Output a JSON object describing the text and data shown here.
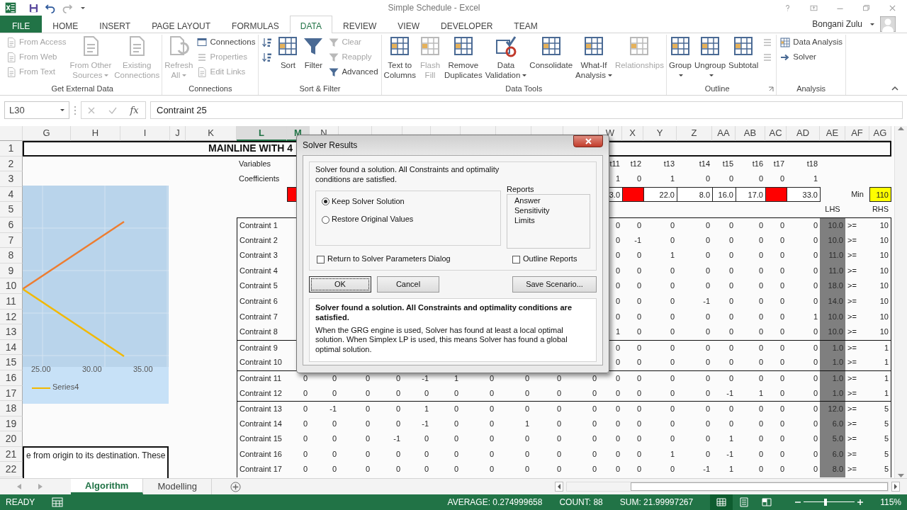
{
  "title_bar": {
    "title": "Simple Schedule - Excel"
  },
  "tabs": [
    {
      "label": "FILE",
      "kind": "file",
      "selected": false
    },
    {
      "label": "HOME",
      "kind": "tab",
      "selected": false
    },
    {
      "label": "INSERT",
      "kind": "tab",
      "selected": false
    },
    {
      "label": "PAGE LAYOUT",
      "kind": "tab",
      "selected": false
    },
    {
      "label": "FORMULAS",
      "kind": "tab",
      "selected": false
    },
    {
      "label": "DATA",
      "kind": "tab",
      "selected": true
    },
    {
      "label": "REVIEW",
      "kind": "tab",
      "selected": false
    },
    {
      "label": "VIEW",
      "kind": "tab",
      "selected": false
    },
    {
      "label": "DEVELOPER",
      "kind": "tab",
      "selected": false
    },
    {
      "label": "TEAM",
      "kind": "tab",
      "selected": false
    }
  ],
  "user": {
    "name": "Bongani Zulu"
  },
  "ribbon": [
    {
      "label": "Get External Data",
      "launcher": false,
      "columns": [
        {
          "kind": "stack",
          "items": [
            {
              "label": "From Access",
              "disabled": true
            },
            {
              "label": "From Web",
              "disabled": true
            },
            {
              "label": "From Text",
              "disabled": true
            }
          ]
        },
        {
          "kind": "large",
          "lines": [
            "From Other",
            "Sources"
          ],
          "dropdown": true,
          "disabled": true
        },
        {
          "kind": "large",
          "lines": [
            "Existing",
            "Connections"
          ],
          "dropdown": false,
          "disabled": true
        }
      ]
    },
    {
      "label": "Connections",
      "launcher": false,
      "columns": [
        {
          "kind": "large",
          "lines": [
            "Refresh",
            "All"
          ],
          "dropdown": true,
          "disabled": true
        },
        {
          "kind": "stack",
          "items": [
            {
              "label": "Connections",
              "disabled": false
            },
            {
              "label": "Properties",
              "disabled": true
            },
            {
              "label": "Edit Links",
              "disabled": true
            }
          ]
        }
      ]
    },
    {
      "label": "Sort & Filter",
      "launcher": false,
      "columns": [
        {
          "kind": "stack",
          "items": [
            {
              "disabled": false
            },
            {
              "disabled": false
            }
          ]
        },
        {
          "kind": "large",
          "lines": [
            "Sort"
          ],
          "dropdown": false,
          "disabled": false
        },
        {
          "kind": "large",
          "lines": [
            "Filter"
          ],
          "dropdown": false,
          "disabled": false
        },
        {
          "kind": "stack",
          "items": [
            {
              "label": "Clear",
              "disabled": true
            },
            {
              "label": "Reapply",
              "disabled": true
            },
            {
              "label": "Advanced",
              "disabled": false
            }
          ]
        }
      ]
    },
    {
      "label": "Data Tools",
      "launcher": false,
      "columns": [
        {
          "kind": "large",
          "lines": [
            "Text to",
            "Columns"
          ],
          "dropdown": false,
          "disabled": false
        },
        {
          "kind": "large",
          "lines": [
            "Flash",
            "Fill"
          ],
          "dropdown": false,
          "disabled": true
        },
        {
          "kind": "large",
          "lines": [
            "Remove",
            "Duplicates"
          ],
          "dropdown": false,
          "disabled": false
        },
        {
          "kind": "large",
          "lines": [
            "Data",
            "Validation"
          ],
          "dropdown": true,
          "disabled": false
        },
        {
          "kind": "large",
          "lines": [
            "Consolidate"
          ],
          "dropdown": false,
          "disabled": false
        },
        {
          "kind": "large",
          "lines": [
            "What-If",
            "Analysis"
          ],
          "dropdown": true,
          "disabled": false
        },
        {
          "kind": "large",
          "lines": [
            "Relationships"
          ],
          "dropdown": false,
          "disabled": true
        }
      ]
    },
    {
      "label": "Outline",
      "launcher": true,
      "columns": [
        {
          "kind": "large",
          "lines": [
            "Group"
          ],
          "dropdown": true,
          "disabled": false
        },
        {
          "kind": "large",
          "lines": [
            "Ungroup"
          ],
          "dropdown": true,
          "disabled": false
        },
        {
          "kind": "large",
          "lines": [
            "Subtotal"
          ],
          "dropdown": false,
          "disabled": false
        },
        {
          "kind": "stack",
          "items": [
            {
              "disabled": true
            },
            {
              "disabled": true
            }
          ]
        }
      ]
    },
    {
      "label": "Analysis",
      "launcher": false,
      "columns": [
        {
          "kind": "stack",
          "items": [
            {
              "label": "Data Analysis",
              "disabled": false
            },
            {
              "label": "Solver",
              "disabled": false
            }
          ]
        }
      ]
    }
  ],
  "formula_bar": {
    "name_box": "L30",
    "function_symbol": "fx",
    "formula": "Contraint 25"
  },
  "sheet": {
    "columns": [
      {
        "letter": "G",
        "selected": false
      },
      {
        "letter": "H",
        "selected": false
      },
      {
        "letter": "I",
        "selected": false
      },
      {
        "letter": "J",
        "selected": false
      },
      {
        "letter": "K",
        "selected": false
      },
      {
        "letter": "L",
        "selected": true
      },
      {
        "letter": "M",
        "selected": true
      },
      {
        "letter": "N",
        "selected": false
      },
      {
        "selected": false
      },
      {
        "selected": false
      },
      {
        "selected": false
      },
      {
        "selected": false
      },
      {
        "selected": false
      },
      {
        "selected": false
      },
      {
        "selected": false
      },
      {
        "selected": false
      },
      {
        "letter": "W",
        "selected": false
      },
      {
        "letter": "X",
        "selected": false
      },
      {
        "letter": "Y",
        "selected": false
      },
      {
        "letter": "Z",
        "selected": false
      },
      {
        "letter": "AA",
        "selected": false
      },
      {
        "letter": "AB",
        "selected": false
      },
      {
        "letter": "AC",
        "selected": false
      },
      {
        "letter": "AD",
        "selected": false
      },
      {
        "letter": "AE",
        "selected": false
      },
      {
        "letter": "AF",
        "selected": false
      },
      {
        "letter": "AG",
        "selected": false
      }
    ],
    "title_row": {
      "number": "1",
      "text": "MAINLINE WITH 4"
    },
    "variables_row": {
      "number": "2",
      "label": "Variables",
      "cells": [
        "t11",
        "t12",
        "t13",
        "t14",
        "t15",
        "t16",
        "t17",
        "t18"
      ]
    },
    "coefficients_row": {
      "number": "3",
      "label": "Coefficients",
      "cells": [
        "1",
        "0",
        "1",
        "0",
        "0",
        "0",
        "0",
        "1"
      ]
    },
    "values_row": {
      "number": "4",
      "lead_cell": {
        "color": "#ff0000"
      },
      "cells": [
        {
          "text": "3.0",
          "color": "#ffffff"
        },
        {
          "color": "#ff0000"
        },
        {
          "text": "22.0",
          "color": "#ffffff"
        },
        {
          "text": "8.0",
          "color": "#ffffff"
        },
        {
          "text": "16.0",
          "color": "#ffffff"
        },
        {
          "text": "17.0",
          "color": "#ffffff"
        },
        {
          "color": "#ff0000"
        },
        {
          "text": "33.0",
          "color": "#ffffff"
        }
      ],
      "objective_label": "Min",
      "objective_value": "110"
    },
    "header_row": {
      "number": "5",
      "lhs": "LHS",
      "rhs": "RHS"
    },
    "constraint_groups": [
      {
        "rows": [
          {
            "number": "6",
            "label": "Contraint 1",
            "cells": [
              "0",
              "0",
              "0",
              "0",
              "0",
              "0",
              "0",
              "0"
            ],
            "lhs": "10.0",
            "op": ">=",
            "rhs": "10"
          },
          {
            "number": "7",
            "label": "Contraint 2",
            "cells": [
              "0",
              "-1",
              "0",
              "0",
              "0",
              "0",
              "0",
              "0"
            ],
            "lhs": "10.0",
            "op": ">=",
            "rhs": "10"
          },
          {
            "number": "8",
            "label": "Contraint 3",
            "cells": [
              "0",
              "0",
              "1",
              "0",
              "0",
              "0",
              "0",
              "0"
            ],
            "lhs": "11.0",
            "op": ">=",
            "rhs": "10"
          },
          {
            "number": "9",
            "label": "Contraint 4",
            "cells": [
              "0",
              "0",
              "0",
              "0",
              "0",
              "0",
              "0",
              "0"
            ],
            "lhs": "11.0",
            "op": ">=",
            "rhs": "10"
          },
          {
            "number": "10",
            "label": "Contraint 5",
            "cells": [
              "0",
              "0",
              "0",
              "0",
              "0",
              "0",
              "0",
              "0"
            ],
            "lhs": "18.0",
            "op": ">=",
            "rhs": "10"
          },
          {
            "number": "11",
            "label": "Contraint 6",
            "cells": [
              "0",
              "0",
              "0",
              "-1",
              "0",
              "0",
              "0",
              "0"
            ],
            "lhs": "14.0",
            "op": ">=",
            "rhs": "10"
          },
          {
            "number": "12",
            "label": "Contraint 7",
            "cells": [
              "0",
              "0",
              "0",
              "0",
              "0",
              "0",
              "0",
              "1"
            ],
            "lhs": "10.0",
            "op": ">=",
            "rhs": "10"
          },
          {
            "number": "13",
            "label": "Contraint 8",
            "cells": [
              "1",
              "0",
              "0",
              "0",
              "0",
              "0",
              "0",
              "0"
            ],
            "lhs": "10.0",
            "op": ">=",
            "rhs": "10"
          }
        ]
      },
      {
        "rows": [
          {
            "number": "14",
            "label": "Contraint 9",
            "cells": [
              "0",
              "0",
              "0",
              "0",
              "0",
              "0",
              "0",
              "0"
            ],
            "lhs": "1.0",
            "op": ">=",
            "rhs": "1"
          },
          {
            "number": "15",
            "label": "Contraint 10",
            "cells": [
              "0",
              "0",
              "0",
              "0",
              "0",
              "0",
              "0",
              "0"
            ],
            "lhs": "1.0",
            "op": ">=",
            "rhs": "1"
          }
        ]
      },
      {
        "rows": [
          {
            "number": "16",
            "label": "Contraint 11",
            "cells": [
              "0",
              "0",
              "0",
              "0",
              "-1",
              "1",
              "0",
              "0",
              "0",
              "0",
              "0",
              "0",
              "0",
              "0",
              "0",
              "0",
              "0",
              "0"
            ],
            "lhs": "1.0",
            "op": ">=",
            "rhs": "1"
          },
          {
            "number": "17",
            "label": "Contraint 12",
            "cells": [
              "0",
              "0",
              "0",
              "0",
              "0",
              "0",
              "0",
              "0",
              "0",
              "0",
              "0",
              "0",
              "0",
              "0",
              "-1",
              "1",
              "0",
              "0"
            ],
            "lhs": "1.0",
            "op": ">=",
            "rhs": "1"
          }
        ]
      },
      {
        "rows": [
          {
            "number": "18",
            "label": "Contraint 13",
            "cells": [
              "0",
              "-1",
              "0",
              "0",
              "1",
              "0",
              "0",
              "0",
              "0",
              "0",
              "0",
              "0",
              "0",
              "0",
              "0",
              "0",
              "0",
              "0"
            ],
            "lhs": "12.0",
            "op": ">=",
            "rhs": "5"
          },
          {
            "number": "19",
            "label": "Contraint 14",
            "cells": [
              "0",
              "0",
              "0",
              "0",
              "-1",
              "0",
              "0",
              "1",
              "0",
              "0",
              "0",
              "0",
              "0",
              "0",
              "0",
              "0",
              "0",
              "0"
            ],
            "lhs": "6.0",
            "op": ">=",
            "rhs": "5"
          },
          {
            "number": "20",
            "label": "Contraint 15",
            "cells": [
              "0",
              "0",
              "0",
              "-1",
              "0",
              "0",
              "0",
              "0",
              "0",
              "0",
              "0",
              "0",
              "0",
              "0",
              "1",
              "0",
              "0",
              "0"
            ],
            "lhs": "5.0",
            "op": ">=",
            "rhs": "5"
          },
          {
            "number": "21",
            "label": "Contraint 16",
            "cells": [
              "0",
              "0",
              "0",
              "0",
              "0",
              "0",
              "0",
              "0",
              "0",
              "0",
              "0",
              "0",
              "1",
              "0",
              "-1",
              "0",
              "0",
              "0"
            ],
            "lhs": "6.0",
            "op": ">=",
            "rhs": "5"
          },
          {
            "number": "22",
            "label": "Contraint 17",
            "cells": [
              "0",
              "0",
              "0",
              "0",
              "0",
              "0",
              "0",
              "0",
              "0",
              "0",
              "0",
              "0",
              "0",
              "-1",
              "1",
              "0",
              "0",
              "0"
            ],
            "lhs": "8.0",
            "op": ">=",
            "rhs": "5"
          }
        ]
      }
    ],
    "chart": {
      "x_ticks": [
        "25.00",
        "30.00",
        "35.00"
      ],
      "legend": [
        {
          "label": "Series4",
          "color": "#f2b800"
        }
      ]
    },
    "text_box": {
      "text": "e from origin to its destination. These"
    }
  },
  "dialog": {
    "title": "Solver Results",
    "message": "Solver found a solution.  All Constraints and optimality conditions are satisfied.",
    "options": [
      {
        "label": "Keep Solver Solution",
        "selected": true
      },
      {
        "label": "Restore Original Values",
        "selected": false
      }
    ],
    "reports_label": "Reports",
    "reports": [
      "Answer",
      "Sensitivity",
      "Limits"
    ],
    "checkboxes": [
      {
        "label": "Return to Solver Parameters Dialog",
        "checked": false
      },
      {
        "label": "Outline Reports",
        "checked": false
      }
    ],
    "buttons": [
      {
        "label": "OK",
        "focused": true
      },
      {
        "label": "Cancel",
        "focused": false
      },
      {
        "label": "Save Scenario...",
        "focused": false
      }
    ],
    "summary_title": "Solver found a solution.  All Constraints and optimality conditions are satisfied.",
    "summary_text": "When the GRG engine is used, Solver has found at least a local optimal solution. When Simplex LP is used, this means Solver has found a global optimal solution."
  },
  "sheet_tabs": [
    {
      "label": "Algorithm",
      "selected": true
    },
    {
      "label": "Modelling",
      "selected": false
    }
  ],
  "status_bar": {
    "mode": "READY",
    "stats": [
      "AVERAGE: 0.274999658",
      "COUNT: 88",
      "SUM: 21.99997267"
    ],
    "views": [
      {
        "selected": true
      },
      {
        "selected": false
      },
      {
        "selected": false
      }
    ],
    "zoom": {
      "level": 0.43,
      "reading": "115%"
    }
  }
}
